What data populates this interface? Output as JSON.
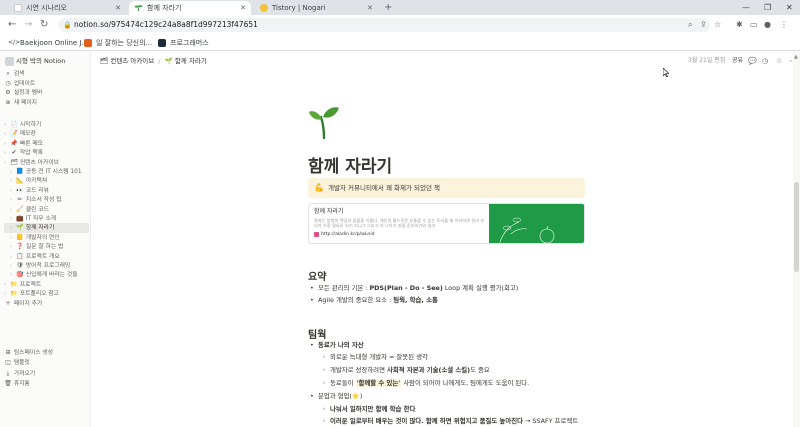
{
  "browser": {
    "tabs": [
      {
        "title": "시연 시나리오",
        "color": "#ffffff",
        "active": false
      },
      {
        "title": "함께 자라기",
        "color": "#ffffff",
        "active": true
      },
      {
        "title": "Tistory | Nogari",
        "color": "#f5c23b",
        "active": false
      }
    ],
    "url": "notion.so/975474c129c24a8a8f1d997213f47651",
    "bookmarks": [
      "Baekjoon Online J...",
      "일 잘하는 당신의...",
      "프로그래머스"
    ]
  },
  "sidebar": {
    "workspace": "시형 박의 Notion",
    "top_items": [
      {
        "icon": "search-icon",
        "glyph": "⌕",
        "label": "검색"
      },
      {
        "icon": "clock-icon",
        "glyph": "◷",
        "label": "업데이트"
      },
      {
        "icon": "gear-icon",
        "glyph": "⚙",
        "label": "설정과 멤버"
      },
      {
        "icon": "plus-icon",
        "glyph": "⊕",
        "label": "새 페이지"
      }
    ],
    "pages": [
      {
        "label": "시작하기",
        "glyph": "📄",
        "indent": 0
      },
      {
        "label": "메모장",
        "glyph": "📝",
        "indent": 0
      },
      {
        "label": "빠른 메모",
        "glyph": "📌",
        "indent": 0
      },
      {
        "label": "작업 목록",
        "glyph": "✔",
        "indent": 0
      },
      {
        "label": "컨텐츠 아카이브",
        "glyph": "🗂",
        "indent": 0
      },
      {
        "label": "공동 전 IT 시스템 101",
        "glyph": "📘",
        "indent": 1
      },
      {
        "label": "아키텍쳐",
        "glyph": "📐",
        "indent": 1
      },
      {
        "label": "코드 리뷰",
        "glyph": "👀",
        "indent": 1
      },
      {
        "label": "지소서 작성 팁",
        "glyph": "✏",
        "indent": 1
      },
      {
        "label": "클린 코드",
        "glyph": "🧹",
        "indent": 1
      },
      {
        "label": "IT 직무 소개",
        "glyph": "💼",
        "indent": 1
      },
      {
        "label": "함께 자라기",
        "glyph": "🌱",
        "indent": 1,
        "active": true
      },
      {
        "label": "개발자의 연인",
        "glyph": "📒",
        "indent": 1
      },
      {
        "label": "질문 잘 하는 법",
        "glyph": "❓",
        "indent": 1
      },
      {
        "label": "프로젝트 개요",
        "glyph": "📋",
        "indent": 1
      },
      {
        "label": "방어적 프로그래밍",
        "glyph": "🛡",
        "indent": 1
      },
      {
        "label": "신입에게 바라는 것들",
        "glyph": "🎯",
        "indent": 1
      },
      {
        "label": "프로젝트",
        "glyph": "📁",
        "indent": 0
      },
      {
        "label": "포트폴리오 참고",
        "glyph": "📁",
        "indent": 0
      },
      {
        "label": "페이지 추가",
        "glyph": "+",
        "indent": 0
      }
    ],
    "bottom_items": [
      {
        "label": "팀스페이스 생성",
        "glyph": "⊞"
      },
      {
        "label": "템플릿",
        "glyph": "◫"
      },
      {
        "label": "가져오기",
        "glyph": "⤓"
      },
      {
        "label": "휴지통",
        "glyph": "🗑"
      }
    ]
  },
  "topbar": {
    "breadcrumb": [
      "컨텐츠 아카이브",
      "함께 자라기"
    ],
    "edited": "3월 21일 편집",
    "share": "공유"
  },
  "page": {
    "icon": "sprout-icon",
    "title": "함께 자라기",
    "callout_icon": "💪",
    "callout": "개발자 커뮤니티에서 꽤 화제가 되었던 책",
    "bookmark": {
      "title": "함께 자라기",
      "desc": "필자는 방법의 핵심과 들을을 이룹다. 개인의 월드로운 유통할 수 없는 트러블 제 유러하면 준비 온리가 가장 필요로 되기 지니그 그리고 어 나아가 방을 준비하기와 실리",
      "url": "http://aladin.kr/p/wLnid"
    },
    "summary_heading": "요약",
    "summary_items": [
      {
        "plain": "모든 관리의 기본 : ",
        "bold": "PDS(Plan - Do - See)",
        "rest": " Loop 계획 실행 평가(회고)"
      },
      {
        "plain": "Agile 개발의 중요한 요소 : ",
        "bold": "팀웍, 학습, 소통",
        "rest": ""
      }
    ],
    "teamwork_heading": "팀웍",
    "teamwork": {
      "item1": "동료가 나의 자산",
      "item1_sub": [
        {
          "plain": "외로운 늑대형 개발자 = 잘못된 생각",
          "bold": "",
          "rest": ""
        },
        {
          "plain": "개발자로 성장하려면 ",
          "bold": "사회적 자본과 기술(소셜 스킬)",
          "rest": "도 중요"
        },
        {
          "plain": "동료들이 ",
          "bold": "'함께할 수 있는'",
          "rest": " 사람이 되어야 나에게도, 팀에게도 도움이 된다."
        }
      ],
      "item2": "분업과 협업(⭐)",
      "item2_sub": [
        {
          "plain": "",
          "bold": "나눠서 일하지만 함께 학습 한다",
          "rest": ""
        },
        {
          "plain": "",
          "bold": "이러운 일로부터 배우는 것이 많다. 함께 하면 위험지고 품질도 높아진다",
          "rest": " → SSAFY 프로젝트"
        }
      ]
    }
  }
}
